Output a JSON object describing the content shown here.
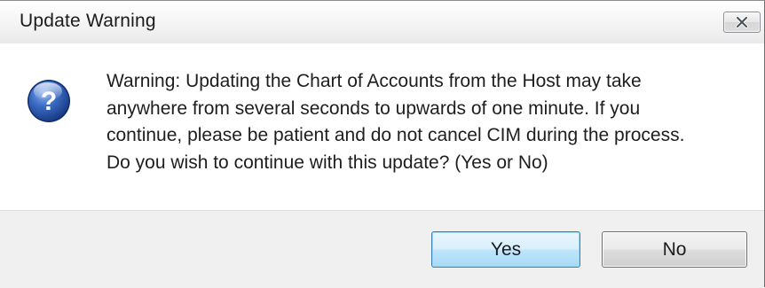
{
  "window": {
    "title": "Update Warning",
    "close_icon": "close-icon"
  },
  "message": {
    "icon": "question-icon",
    "lines": [
      "Warning: Updating the Chart of Accounts from the Host may take",
      "anywhere from several seconds to upwards of one minute. If you",
      "continue, please be patient and do not cancel CIM during the process.",
      "Do you wish to continue with this update? (Yes or No)"
    ]
  },
  "buttons": {
    "yes_label": "Yes",
    "no_label": "No",
    "default": "yes"
  },
  "colors": {
    "icon_blue": "#1f4fa3",
    "default_button_border": "#3c7fb1"
  }
}
